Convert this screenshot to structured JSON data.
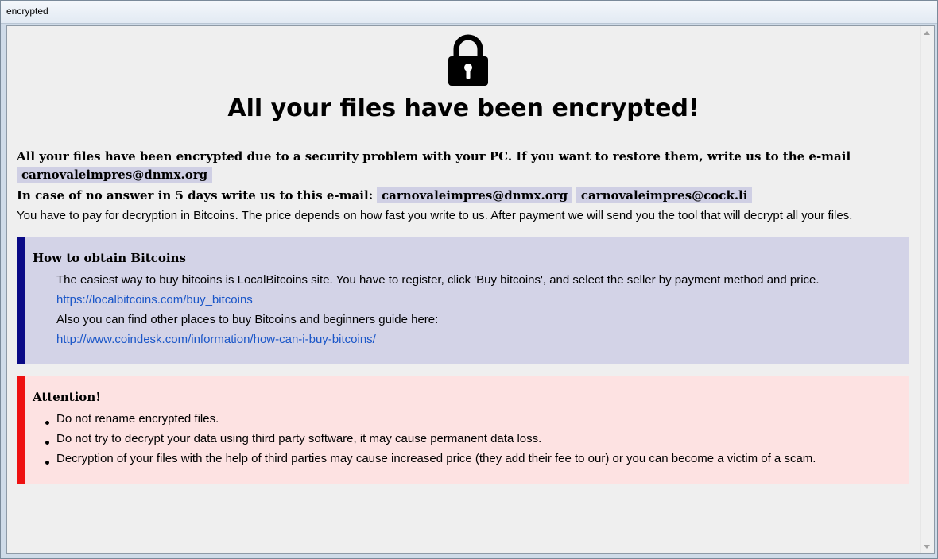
{
  "window": {
    "title": "encrypted"
  },
  "icons": {
    "lock": "padlock-icon"
  },
  "headline": "All your files have been encrypted!",
  "intro": {
    "line1": "All your files have been encrypted due to a security problem with your PC. If you want to restore them, write us to the e-mail",
    "email_primary": "carnovaleimpres@dnmx.org",
    "line2_prefix": "In case of no answer in 5 days write us to this e-mail:",
    "email_secondary_1": "carnovaleimpres@dnmx.org",
    "email_secondary_2": "carnovaleimpres@cock.li",
    "line3": "You have to pay for decryption in Bitcoins. The price depends on how fast you write to us. After payment we will send you the tool that will decrypt all your files."
  },
  "bitcoin_box": {
    "heading": "How to obtain Bitcoins",
    "p1": "The easiest way to buy bitcoins is LocalBitcoins site. You have to register, click 'Buy bitcoins', and select the seller by payment method and price.",
    "link1": "https://localbitcoins.com/buy_bitcoins",
    "p2": "Also you can find other places to buy Bitcoins and beginners guide here:",
    "link2": "http://www.coindesk.com/information/how-can-i-buy-bitcoins/"
  },
  "attention_box": {
    "heading": "Attention!",
    "items": [
      "Do not rename encrypted files.",
      "Do not try to decrypt your data using third party software, it may cause permanent data loss.",
      "Decryption of your files with the help of third parties may cause increased price (they add their fee to our) or you can become a victim of a scam."
    ]
  },
  "colors": {
    "info_accent": "#0a0a86",
    "info_bg": "#d3d3e7",
    "warn_accent": "#ee1111",
    "warn_bg": "#fde2e2",
    "link": "#1a56c8",
    "email_bg": "#cfcfe4"
  }
}
